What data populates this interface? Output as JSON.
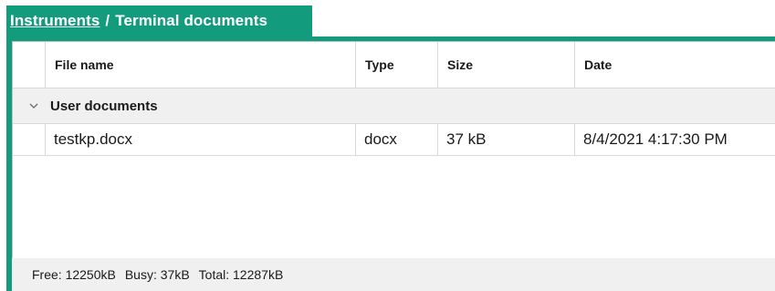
{
  "breadcrumb": {
    "root": "Instruments",
    "separator": "/",
    "current": "Terminal documents"
  },
  "table": {
    "columns": [
      "File name",
      "Type",
      "Size",
      "Date"
    ],
    "groups": [
      {
        "label": "User documents",
        "expanded": true,
        "rows": [
          {
            "file_name": "testkp.docx",
            "type": "docx",
            "size": "37 kB",
            "date": "8/4/2021 4:17:30 PM"
          }
        ]
      }
    ]
  },
  "status": {
    "free": "Free: 12250kB",
    "busy": "Busy: 37kB",
    "total": "Total: 12287kB"
  },
  "colors": {
    "accent": "#139b7d",
    "group_background": "#f0f0f0",
    "grid": "#d9d9d9"
  },
  "icons": {
    "group_toggle": "chevron-down-icon"
  }
}
